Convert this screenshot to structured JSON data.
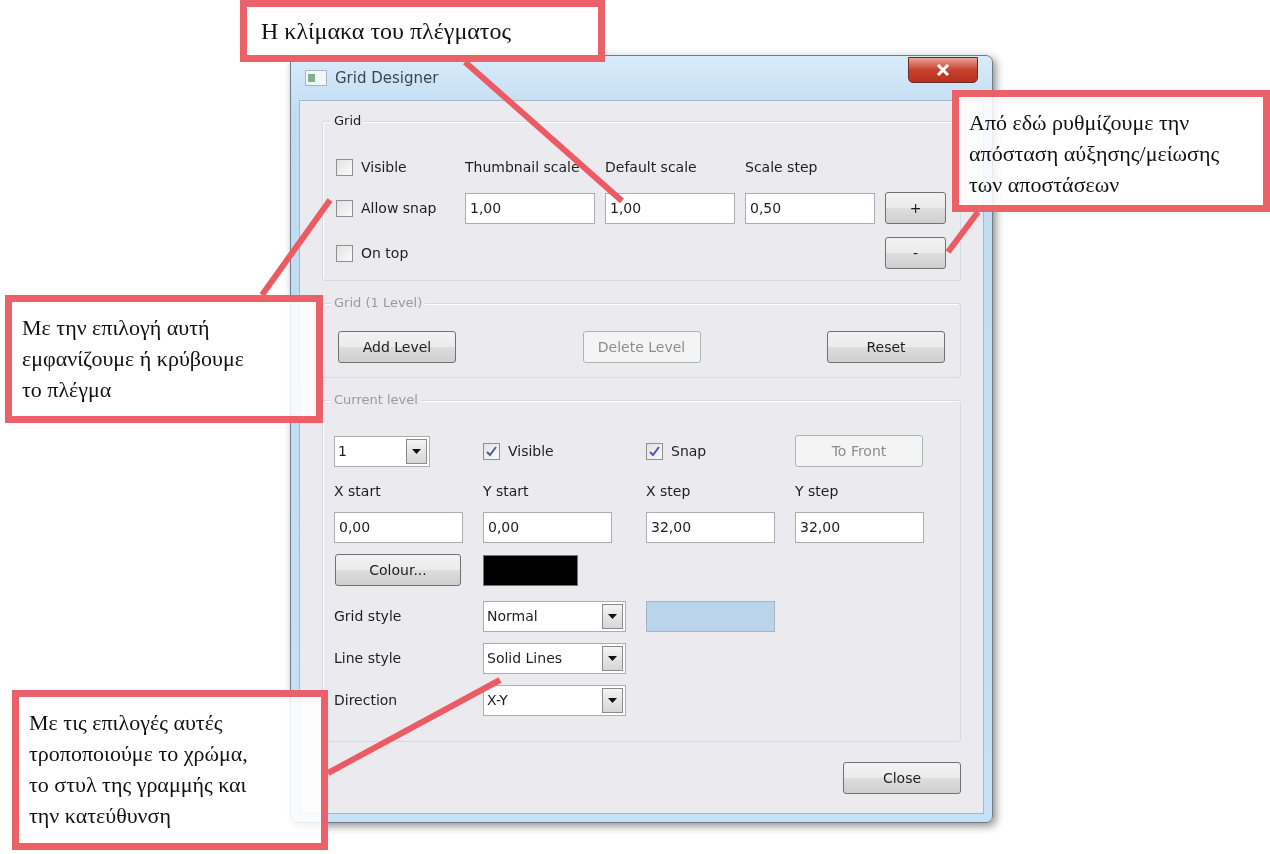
{
  "window": {
    "title": "Grid Designer"
  },
  "grid": {
    "label": "Grid",
    "checkboxes": [
      {
        "label": "Visible",
        "checked": false
      },
      {
        "label": "Allow snap",
        "checked": false
      },
      {
        "label": "On top",
        "checked": false
      }
    ],
    "fields": [
      {
        "label": "Thumbnail scale",
        "value": "1,00"
      },
      {
        "label": "Default scale",
        "value": "1,00"
      },
      {
        "label": "Scale step",
        "value": "0,50"
      }
    ],
    "step_buttons": [
      "+",
      "-"
    ]
  },
  "levels": {
    "label": "Grid (1 Level)",
    "buttons": [
      {
        "label": "Add Level",
        "disabled": false
      },
      {
        "label": "Delete Level",
        "disabled": true
      },
      {
        "label": "Reset",
        "disabled": false
      }
    ]
  },
  "current_level": {
    "label": "Current level",
    "level_select": "1",
    "checkboxes": [
      {
        "label": "Visible",
        "checked": true
      },
      {
        "label": "Snap",
        "checked": true
      }
    ],
    "to_front": {
      "label": "To Front",
      "disabled": true
    },
    "fields": [
      {
        "label": "X start",
        "value": "0,00"
      },
      {
        "label": "Y start",
        "value": "0,00"
      },
      {
        "label": "X step",
        "value": "32,00"
      },
      {
        "label": "Y step",
        "value": "32,00"
      }
    ],
    "colour_button": "Colour...",
    "selects": [
      {
        "label": "Grid style",
        "value": "Normal"
      },
      {
        "label": "Line style",
        "value": "Solid Lines"
      },
      {
        "label": "Direction",
        "value": "X-Y"
      }
    ]
  },
  "close_button": "Close",
  "callouts": [
    {
      "text": "Η κλίμακα του πλέγματος"
    },
    {
      "text": "Από εδώ ρυθμίζουμε την\nαπόσταση αύξησης/μείωσης\nτων αποστάσεων"
    },
    {
      "text": "Με την επιλογή αυτή\nεμφανίζουμε ή κρύβουμε\nτο πλέγμα"
    },
    {
      "text": "Με τις επιλογές αυτές\nτροποποιούμε το χρώμα,\nτο στυλ της γραμμής και\nτην κατεύθυνση"
    }
  ]
}
